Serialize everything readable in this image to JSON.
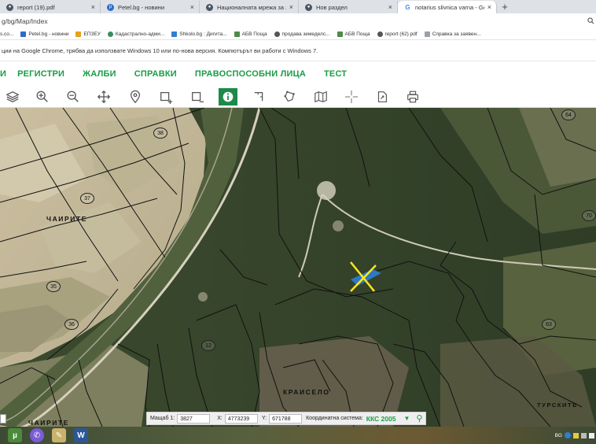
{
  "browser": {
    "tabs": [
      {
        "title": "report (19).pdf",
        "close": "×"
      },
      {
        "title": "Petel.bg - новини",
        "close": "×"
      },
      {
        "title": "Националната мрежа за земеде",
        "close": "×"
      },
      {
        "title": "Нов раздел",
        "close": "×"
      },
      {
        "title": "notarius slivnica varna - Google",
        "close": "×"
      }
    ],
    "new_tab": "+",
    "url": "g/bg/Map/Index",
    "bookmarks": [
      "s.co...",
      "Petel.bg - новини",
      "ЕПЗЕУ",
      "Кадастрално-адми...",
      "Shkolo.bg : Дигита...",
      "АБВ Поща",
      "продава земеделс...",
      "АБВ Поща",
      "report (62).pdf",
      "Справка за заявен..."
    ],
    "info_message": "ции на Google Chrome, трябва да използвате Windows 10 или по-нова версия. Компютърът ви работи с Windows 7."
  },
  "site": {
    "nav": [
      "И",
      "РЕГИСТРИ",
      "ЖАЛБИ",
      "СПРАВКИ",
      "ПРАВОСПОСОБНИ ЛИЦА",
      "ТЕСТ"
    ]
  },
  "toolbar": {
    "tools": [
      "layers-icon",
      "zoom-in-icon",
      "zoom-out-icon",
      "pan-icon",
      "location-pin-icon",
      "select-rect-icon",
      "deselect-rect-icon",
      "info-icon",
      "measure-icon",
      "draw-polygon-icon",
      "map-icon",
      "crosshair-icon",
      "export-icon",
      "print-icon"
    ],
    "active_tool": "info-icon",
    "accent": "#1e8a4a"
  },
  "map": {
    "plot_numbers": [
      "64",
      "38",
      "37",
      "70",
      "35",
      "36",
      "12",
      "63"
    ],
    "labels": [
      "ЧАИРИТЕ",
      "КРАИСЕЛО",
      "ЧАИРИТЕ",
      "ТУРСКИТЕ"
    ]
  },
  "status": {
    "scale_label": "Мащаб 1:",
    "scale_value": "3827",
    "x_label": "X:",
    "x_value": "4773239",
    "y_label": "Y:",
    "y_value": "671788",
    "system_label": "Координатна система:",
    "system_value": "ККС 2005",
    "dropdown": "▼",
    "search": "⚲"
  },
  "taskbar": {
    "tray_text": "BG"
  },
  "colors": {
    "brand_green": "#1a9c46",
    "marker_blue": "#2f7fd1",
    "marker_yellow": "#ffe81a"
  }
}
